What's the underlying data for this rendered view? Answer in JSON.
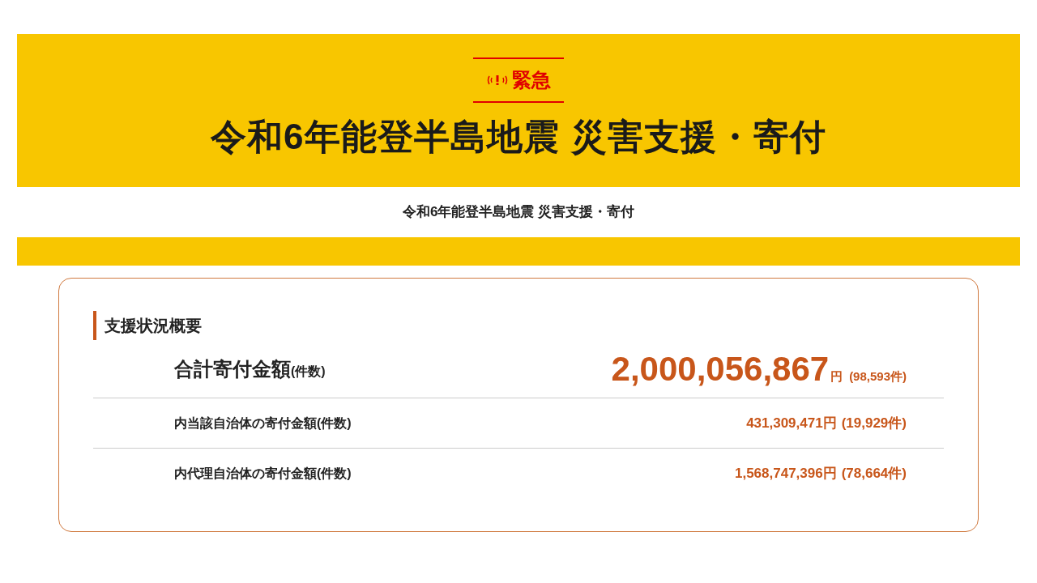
{
  "banner": {
    "badge": "緊急",
    "title": "令和6年能登半島地震 災害支援・寄付"
  },
  "subtitle": "令和6年能登半島地震 災害支援・寄付",
  "summary": {
    "heading": "支援状況概要",
    "rows": [
      {
        "kind": "total",
        "label": "合計寄付金額",
        "label_note": "(件数)",
        "amount": "2,000,056,867",
        "unit": "円",
        "count": "(98,593件)"
      },
      {
        "kind": "sub",
        "label": "内当該自治体の寄付金額(件数)",
        "amount": "431,309,471",
        "unit": "円",
        "count": "(19,929件)"
      },
      {
        "kind": "sub",
        "label": "内代理自治体の寄付金額(件数)",
        "amount": "1,568,747,396",
        "unit": "円",
        "count": "(78,664件)"
      }
    ]
  }
}
